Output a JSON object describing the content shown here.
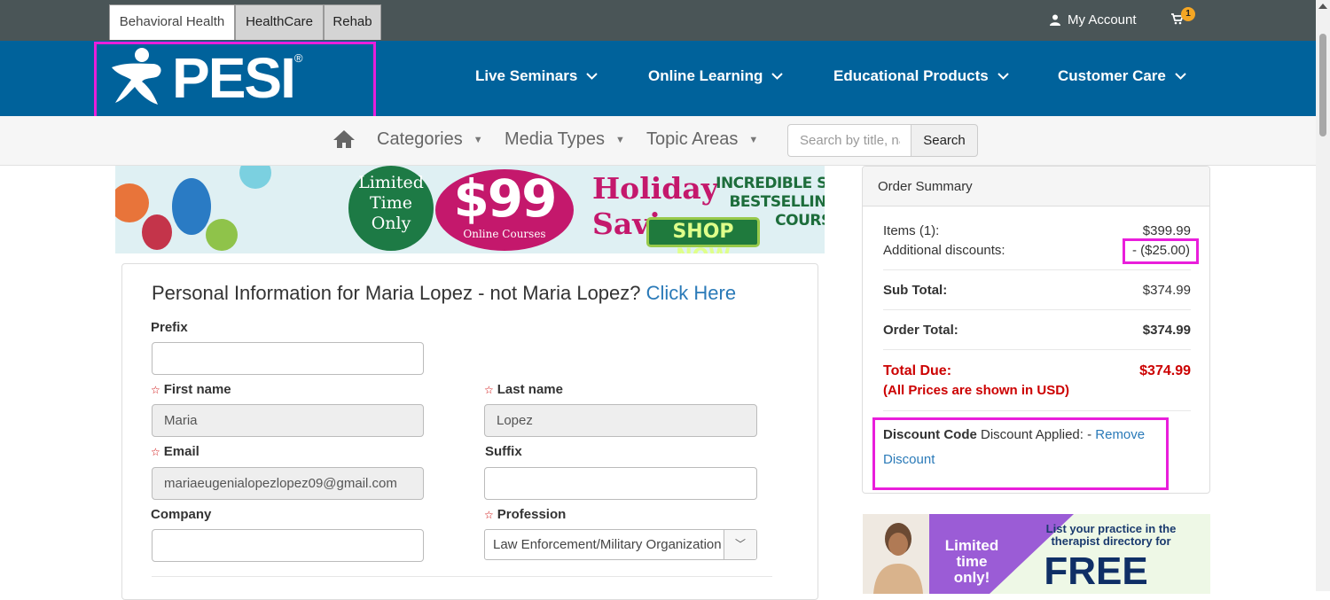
{
  "site_tabs": [
    {
      "label": "Behavioral Health"
    },
    {
      "label": "HealthCare"
    },
    {
      "label": "Rehab"
    }
  ],
  "account": {
    "label": "My Account",
    "icon": "user-icon"
  },
  "cart": {
    "count": "1",
    "icon": "cart-icon"
  },
  "logo": {
    "text": "PESI",
    "reg": "®"
  },
  "main_nav": [
    {
      "label": "Live Seminars"
    },
    {
      "label": "Online Learning"
    },
    {
      "label": "Educational Products"
    },
    {
      "label": "Customer Care"
    }
  ],
  "sub_nav": [
    {
      "label": "Categories"
    },
    {
      "label": "Media Types"
    },
    {
      "label": "Topic Areas"
    }
  ],
  "search": {
    "placeholder": "Search by title, name",
    "button": "Search"
  },
  "banner": {
    "limited": "Limited Time Only",
    "price": "$99",
    "price_sub": "Online Courses",
    "holiday": "Holiday Savings",
    "incredible": "INCREDIBLE SAVINGS ON BESTSELLING ONLINE COURSES!",
    "shop": "SHOP NOW"
  },
  "form": {
    "title": "Personal Information for Maria Lopez - not Maria Lopez?",
    "click_here": "Click Here",
    "prefix_label": "Prefix",
    "prefix_value": "",
    "first_label": "First name",
    "first_value": "Maria",
    "last_label": "Last name",
    "last_value": "Lopez",
    "email_label": "Email",
    "email_value": "mariaeugenialopezlopez09@gmail.com",
    "suffix_label": "Suffix",
    "suffix_value": "",
    "company_label": "Company",
    "company_value": "",
    "profession_label": "Profession",
    "profession_value": "Law Enforcement/Military Organization"
  },
  "summary": {
    "title": "Order Summary",
    "items_label": "Items (1):",
    "items_value": "$399.99",
    "discounts_label": "Additional discounts:",
    "discounts_value": "- ($25.00)",
    "subtotal_label": "Sub Total:",
    "subtotal_value": "$374.99",
    "order_total_label": "Order Total:",
    "order_total_value": "$374.99",
    "total_due_label": "Total Due:",
    "total_due_value": "$374.99",
    "usd_note": "(All Prices are shown in USD)",
    "code_label": "Discount Code",
    "code_applied": "Discount Applied: -",
    "remove_link": "Remove Discount"
  },
  "directory_ad": {
    "limited": "Limited time only!",
    "list_text": "List your practice in the therapist directory for",
    "free": "FREE"
  },
  "colors": {
    "topbar": "#4a5557",
    "navbar": "#00629b",
    "highlight": "#e91edb",
    "link": "#2a7ab8",
    "total_due": "#cc0000"
  }
}
